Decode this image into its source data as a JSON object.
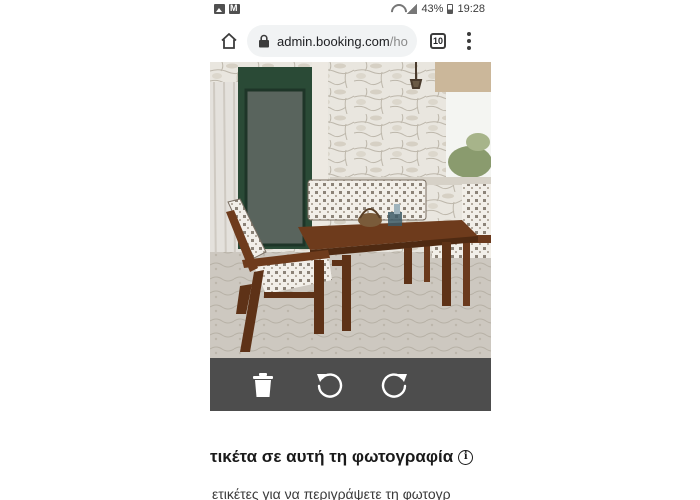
{
  "status_bar": {
    "battery": "43%",
    "time": "19:28"
  },
  "browser": {
    "url_host": "admin.booking.com",
    "url_path": "/ho",
    "tab_count": "10"
  },
  "photo": {
    "description": "Outdoor patio with wooden table, bench and armchair"
  },
  "photo_actions": {
    "icons": [
      "trash-icon",
      "rotate-left-icon",
      "rotate-right-icon"
    ]
  },
  "tags": {
    "heading": "τικέτα σε αυτή τη φωτογραφία",
    "description": "ετικέτες για να περιγράψετε τη φωτογρ"
  },
  "colors": {
    "action_bar": "#4d4d4d",
    "url_pill": "#f1f3f4"
  }
}
